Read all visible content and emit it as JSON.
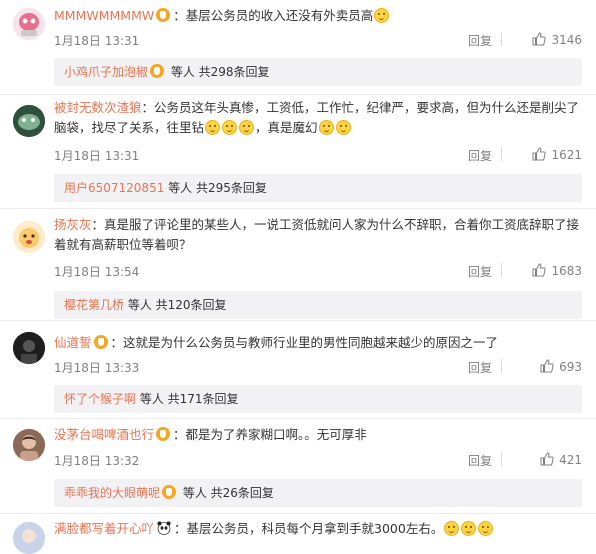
{
  "comments": [
    {
      "username": "MMMWMMMMW",
      "text": "：基层公务员的收入还没有外卖员高",
      "emoji_count": 1,
      "time": "1月18日 13:31",
      "reply_label": "回复",
      "likes": "3146",
      "sub_user": "小鸡爪子加泡椒",
      "sub_suffix": " 等人 共298条回复"
    },
    {
      "username": "被封无数次渣狼",
      "text": "：公务员这年头真惨，工资低，工作忙，纪律严，要求高，但为什么还是削尖了脑袋，找尽了关系，往里钻",
      "text_tail": "，真是魔幻",
      "time": "1月18日 13:31",
      "reply_label": "回复",
      "likes": "1621",
      "sub_user": "用户6507120851",
      "sub_suffix": " 等人 共295条回复"
    },
    {
      "username": "扬灰灰",
      "text": "：真是服了评论里的某些人，一说工资低就问人家为什么不辞职，合着你工资底辞职了接着就有高薪职位等着呗？",
      "time": "1月18日 13:54",
      "reply_label": "回复",
      "likes": "1683",
      "sub_user": "樱花第几桥",
      "sub_suffix": " 等人 共120条回复"
    },
    {
      "username": "仙道誓",
      "text": "：这就是为什么公务员与教师行业里的男性同胞越来越少的原因之一了",
      "time": "1月18日 13:33",
      "reply_label": "回复",
      "likes": "693",
      "sub_user": "怀了个猴子啊",
      "sub_suffix": " 等人 共171条回复"
    },
    {
      "username": "没茅台喝啤酒也行",
      "text": "：都是为了养家糊口啊。。无可厚非",
      "time": "1月18日 13:32",
      "reply_label": "回复",
      "likes": "421",
      "sub_user": "乖乖我的大眼萌呢",
      "sub_suffix": " 等人 共26条回复"
    },
    {
      "username": "满脸都写着开心吖",
      "text": "：基层公务员，科员每个月拿到手就3000左右。"
    }
  ],
  "colors": {
    "username": "#eb7350",
    "meta": "#808080",
    "sub_bg": "#f2f2f5"
  }
}
